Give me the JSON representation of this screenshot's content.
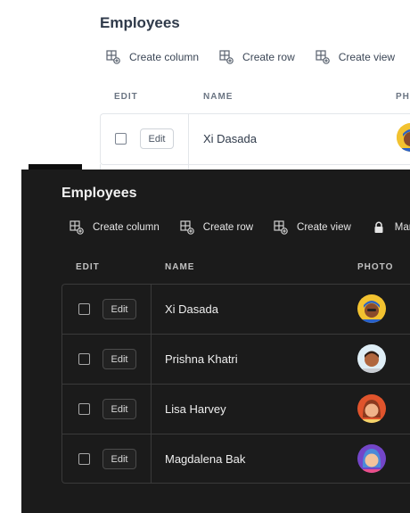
{
  "light": {
    "title": "Employees",
    "toolbar": [
      {
        "label": "Create column",
        "icon": "create-column-icon"
      },
      {
        "label": "Create row",
        "icon": "create-row-icon"
      },
      {
        "label": "Create view",
        "icon": "create-view-icon"
      }
    ],
    "headers": {
      "edit": "EDIT",
      "name": "NAME",
      "photo": "PHO"
    },
    "rows": [
      {
        "edit": "Edit",
        "name": "Xi Dasada",
        "avatar_color": "#f2c230"
      }
    ]
  },
  "dark": {
    "title": "Employees",
    "toolbar": [
      {
        "label": "Create column",
        "icon": "create-column-icon"
      },
      {
        "label": "Create row",
        "icon": "create-row-icon"
      },
      {
        "label": "Create view",
        "icon": "create-view-icon"
      },
      {
        "label": "Mar",
        "icon": "lock-icon"
      }
    ],
    "headers": {
      "edit": "EDIT",
      "name": "NAME",
      "photo": "PHOTO"
    },
    "rows": [
      {
        "edit": "Edit",
        "name": "Xi Dasada",
        "avatar_color": "#f2c230",
        "skin": "#8a4a2a",
        "hair": "#2a62c9"
      },
      {
        "edit": "Edit",
        "name": "Prishna Khatri",
        "avatar_color": "#dfeef6",
        "skin": "#b0663e",
        "hair": "#2d1c14"
      },
      {
        "edit": "Edit",
        "name": "Lisa Harvey",
        "avatar_color": "#e0542c",
        "skin": "#f0b48a",
        "hair": "#8b3a1f"
      },
      {
        "edit": "Edit",
        "name": "Magdalena Bak",
        "avatar_color": "#7346c8",
        "skin": "#f3c39c",
        "hair": "#4c8ad8"
      }
    ]
  },
  "colors": {
    "dark_bg": "#1b1b1b",
    "light_bg": "#ffffff"
  }
}
